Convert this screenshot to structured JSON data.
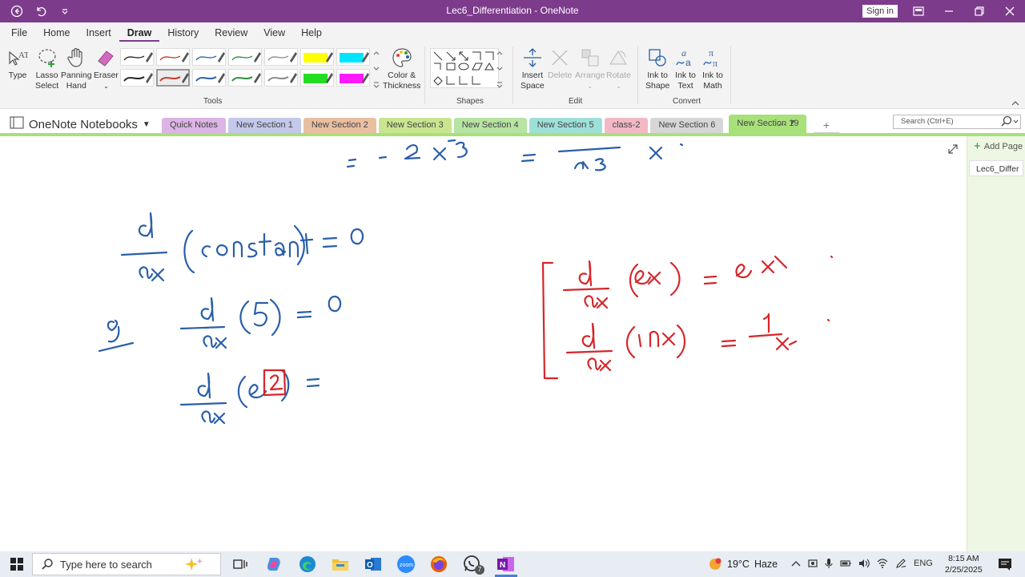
{
  "window": {
    "title": "Lec6_Differentiation - OneNote",
    "sign_in": "Sign in"
  },
  "menu": {
    "tabs": [
      "File",
      "Home",
      "Insert",
      "Draw",
      "History",
      "Review",
      "View",
      "Help"
    ],
    "active": "Draw"
  },
  "ribbon": {
    "tools_group": "Tools",
    "shapes_group": "Shapes",
    "edit_group": "Edit",
    "convert_group": "Convert",
    "type": "Type",
    "lasso_1": "Lasso",
    "lasso_2": "Select",
    "panning_1": "Panning",
    "panning_2": "Hand",
    "eraser": "Eraser",
    "color_1": "Color &",
    "color_2": "Thickness",
    "insert_space_1": "Insert",
    "insert_space_2": "Space",
    "delete": "Delete",
    "arrange": "Arrange",
    "rotate": "Rotate",
    "ink_shape_1": "Ink to",
    "ink_shape_2": "Shape",
    "ink_text_1": "Ink to",
    "ink_text_2": "Text",
    "ink_math_1": "Ink to",
    "ink_math_2": "Math",
    "pen_colors": [
      "#222222",
      "#c0392b",
      "#2a5fa8",
      "#2e8b3a",
      "#888888",
      "#ffff00",
      "#00e5ff",
      "#222222",
      "#c0392b",
      "#2a5fa8",
      "#2e8b3a",
      "#888888",
      "#22dd22",
      "#ff1aff"
    ]
  },
  "notebook": {
    "name": "OneNote Notebooks",
    "sections": [
      {
        "label": "Quick Notes",
        "color": "#dcb4e6"
      },
      {
        "label": "New Section 1",
        "color": "#c4c8ea"
      },
      {
        "label": "New Section 2",
        "color": "#e9bfa2"
      },
      {
        "label": "New Section 3",
        "color": "#c9e590"
      },
      {
        "label": "New Section 4",
        "color": "#b7e3a3"
      },
      {
        "label": "New Section 5",
        "color": "#9ee0d8"
      },
      {
        "label": "class-2",
        "color": "#f2b8c6"
      },
      {
        "label": "New Section 6",
        "color": "#d6d6d6"
      },
      {
        "label": "New Section 19",
        "color": "#a8e07a"
      }
    ],
    "more": "...",
    "search_placeholder": "Search (Ctrl+E)"
  },
  "pages": {
    "add_page": "Add Page",
    "items": [
      "Lec6_Differ"
    ]
  },
  "ink": {
    "blue": "#2a5fa8",
    "red": "#d6262a"
  },
  "taskbar": {
    "search_placeholder": "Type here to search",
    "weather_temp": "19°C",
    "weather_desc": "Haze",
    "language": "ENG",
    "time": "8:15 AM",
    "date": "2/25/2025",
    "whatsapp_badge": "7"
  }
}
